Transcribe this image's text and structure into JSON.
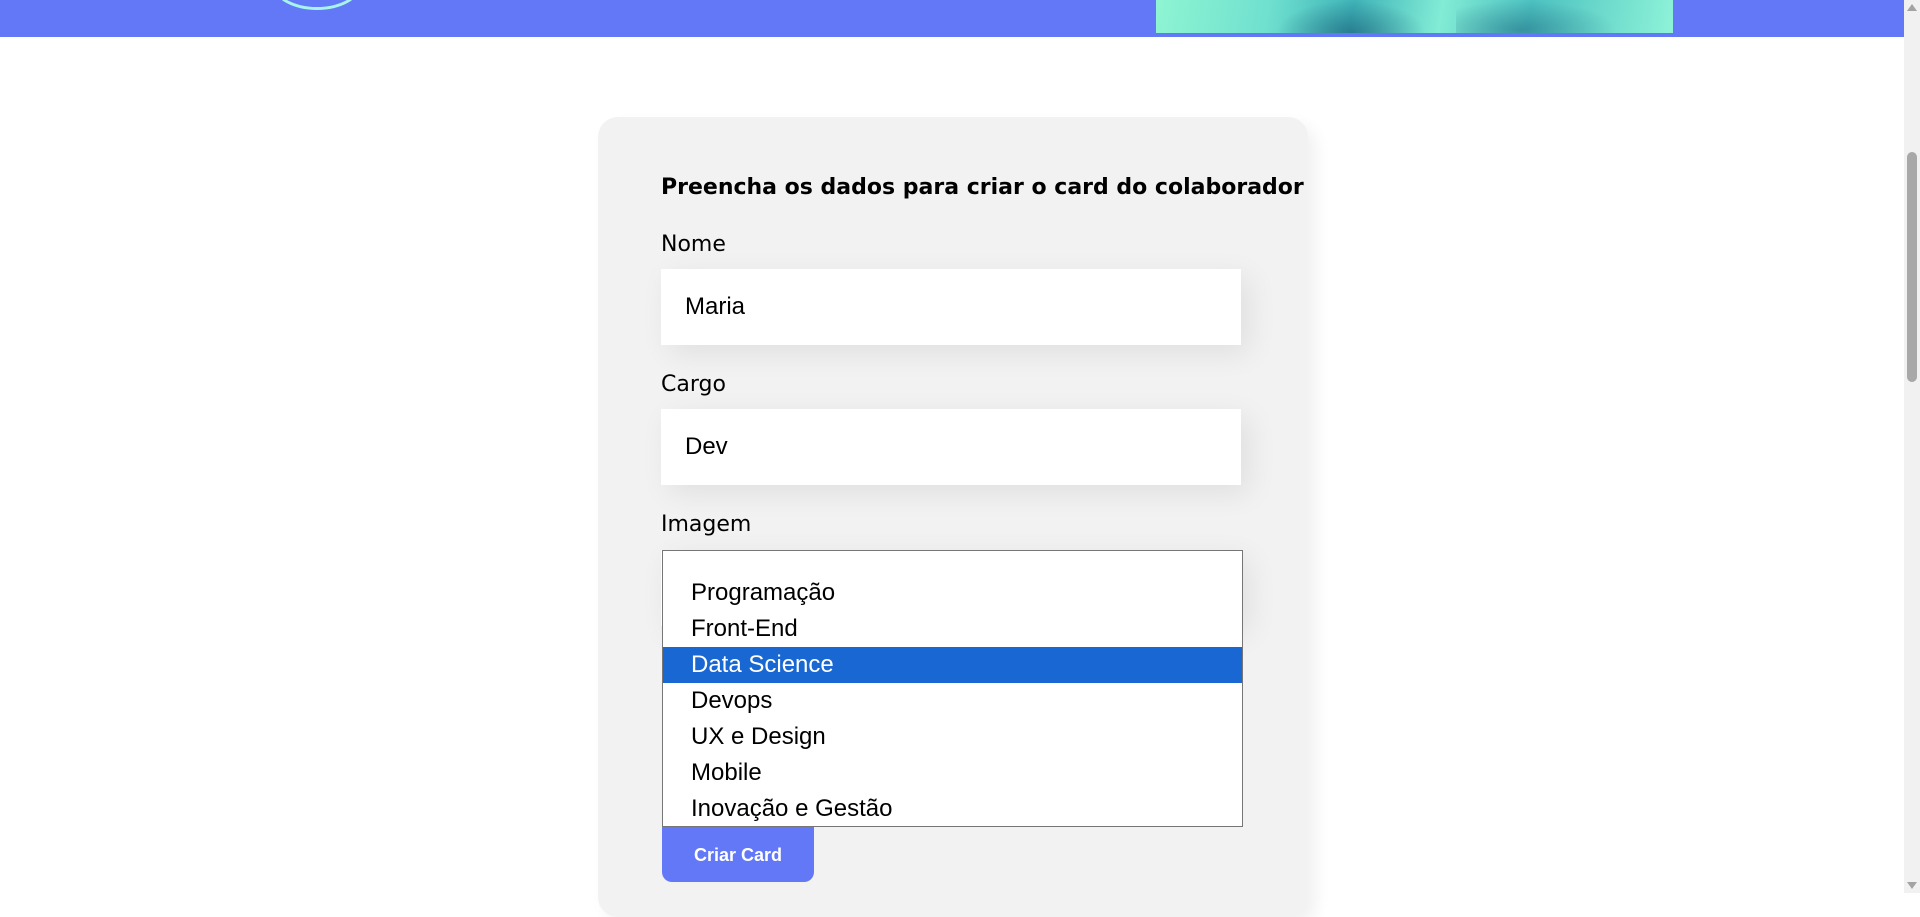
{
  "banner": {
    "colors": {
      "background": "#6278f7",
      "circle": "#a7f5ea"
    }
  },
  "form": {
    "title": "Preencha os dados para criar o card do colaborador",
    "fields": {
      "nome": {
        "label": "Nome",
        "value": "Maria"
      },
      "cargo": {
        "label": "Cargo",
        "value": "Dev"
      },
      "imagem": {
        "label": "Imagem"
      }
    },
    "team_select": {
      "options": [
        {
          "label": ""
        },
        {
          "label": "Programação"
        },
        {
          "label": "Front-End"
        },
        {
          "label": "Data Science"
        },
        {
          "label": "Devops"
        },
        {
          "label": "UX e Design"
        },
        {
          "label": "Mobile"
        },
        {
          "label": "Inovação e Gestão"
        }
      ],
      "highlighted": "Data Science",
      "highlight_color": "#1967d2"
    },
    "submit_label": "Criar Card",
    "colors": {
      "card_background": "#f2f2f2",
      "button": "#6278f7"
    }
  }
}
